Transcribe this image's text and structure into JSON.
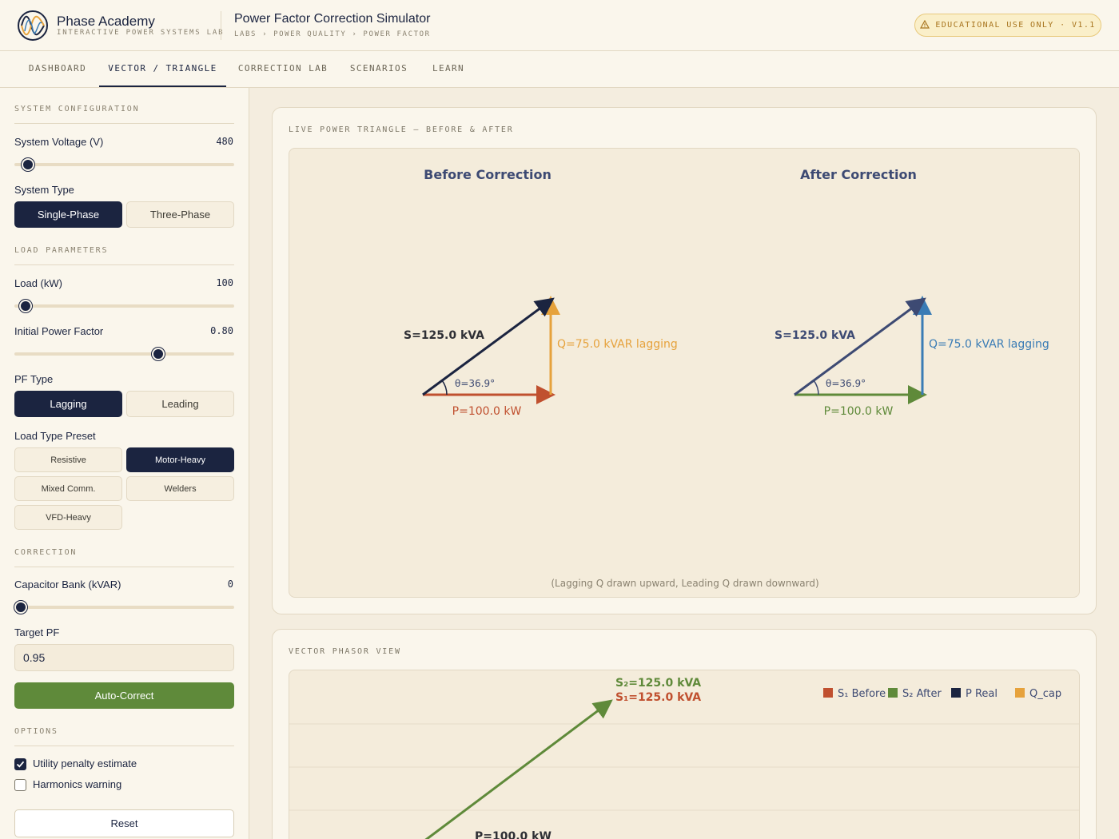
{
  "header": {
    "brand_name": "Phase Academy",
    "brand_sub": "INTERACTIVE POWER SYSTEMS LAB",
    "app_title": "Power Factor Correction Simulator",
    "breadcrumb": "LABS › POWER QUALITY › POWER FACTOR",
    "badge": "EDUCATIONAL USE ONLY · V1.1"
  },
  "nav": {
    "tabs": [
      {
        "label": "DASHBOARD"
      },
      {
        "label": "VECTOR / TRIANGLE"
      },
      {
        "label": "CORRECTION LAB"
      },
      {
        "label": "SCENARIOS"
      },
      {
        "label": "LEARN"
      }
    ],
    "active": "VECTOR / TRIANGLE"
  },
  "sidebar": {
    "system_config": {
      "title": "SYSTEM CONFIGURATION",
      "voltage_label": "System Voltage (V)",
      "voltage_value": "480",
      "voltage_fraction": 0.06,
      "system_type_label": "System Type",
      "system_types": [
        "Single-Phase",
        "Three-Phase"
      ],
      "system_type_selected": "Single-Phase"
    },
    "load": {
      "title": "LOAD PARAMETERS",
      "load_label": "Load (kW)",
      "load_value": "100",
      "load_fraction": 0.05,
      "pf_label": "Initial Power Factor",
      "pf_value": "0.80",
      "pf_fraction": 0.655,
      "pf_type_label": "PF Type",
      "pf_types": [
        "Lagging",
        "Leading"
      ],
      "pf_type_selected": "Lagging",
      "preset_label": "Load Type Preset",
      "presets": [
        "Resistive",
        "Motor-Heavy",
        "Mixed Comm.",
        "Welders",
        "VFD-Heavy"
      ],
      "preset_selected": "Motor-Heavy"
    },
    "correction": {
      "title": "CORRECTION",
      "cap_label": "Capacitor Bank (kVAR)",
      "cap_value": "0",
      "cap_fraction": 0.03,
      "target_label": "Target PF",
      "target_value": "0.95",
      "auto_label": "Auto-Correct"
    },
    "options": {
      "title": "OPTIONS",
      "items": [
        {
          "label": "Utility penalty estimate",
          "checked": true
        },
        {
          "label": "Harmonics warning",
          "checked": false
        }
      ],
      "reset_label": "Reset"
    }
  },
  "triangle_card": {
    "title": "LIVE POWER TRIANGLE — BEFORE & AFTER",
    "before": {
      "heading": "Before Correction",
      "s_label": "S=125.0 kVA",
      "q_label": "Q=75.0 kVAR lagging",
      "p_label": "P=100.0 kW",
      "theta_label": "θ=36.9°"
    },
    "after": {
      "heading": "After Correction",
      "s_label": "S=125.0 kVA",
      "q_label": "Q=75.0 kVAR lagging",
      "p_label": "P=100.0 kW",
      "theta_label": "θ=36.9°"
    },
    "note": "(Lagging Q drawn upward, Leading Q drawn downward)"
  },
  "phasor_card": {
    "title": "VECTOR PHASOR VIEW",
    "s2_label": "S₂=125.0 kVA",
    "s1_label": "S₁=125.0 kVA",
    "p_label": "P=100.0 kW",
    "legend": [
      {
        "label": "S₁ Before",
        "color": "#c0502f"
      },
      {
        "label": "S₂ After",
        "color": "#5f8a3a"
      },
      {
        "label": "P Real",
        "color": "#1b2440"
      },
      {
        "label": "Q_cap",
        "color": "#e6a23c"
      }
    ]
  },
  "colors": {
    "navy": "#1b2440",
    "real_power": "#c0502f",
    "reactive_lagging": "#e6a23c",
    "after_real": "#5f8a3a",
    "after_reactive": "#3a7cb5",
    "after_apparent": "#3d4a73"
  }
}
